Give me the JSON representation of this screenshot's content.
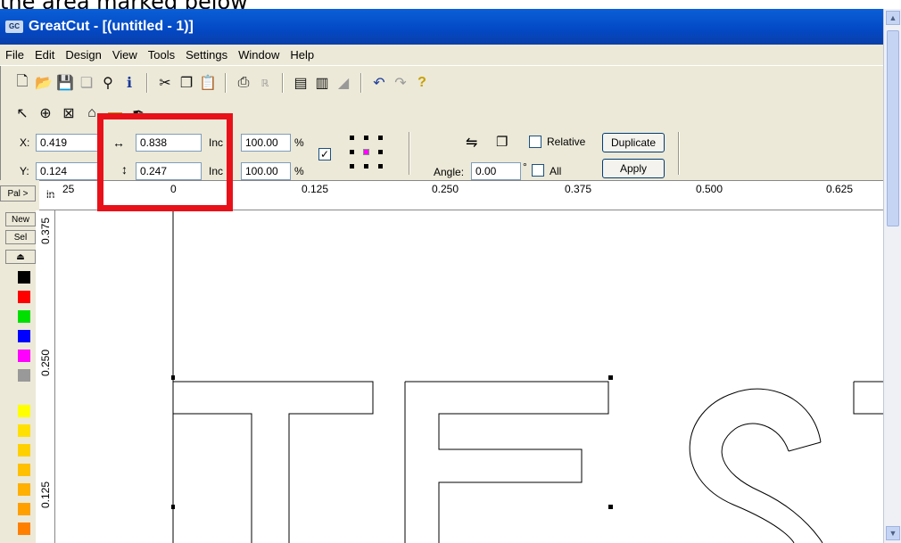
{
  "caption": "the area marked below",
  "window": {
    "title": "GreatCut  - [(untitled - 1)]",
    "icon": "greatcut-app-icon"
  },
  "menu": [
    "File",
    "Edit",
    "Design",
    "View",
    "Tools",
    "Settings",
    "Window",
    "Help"
  ],
  "toolbar": {
    "icons": [
      "new-icon",
      "open-icon",
      "save-icon",
      "gray-icon",
      "preview-icon",
      "info-icon",
      "cut-icon",
      "copy-icon",
      "paste-icon",
      "print-icon",
      "register-icon",
      "page-icon",
      "export-icon",
      "eraser-icon",
      "undo-icon",
      "redo-icon",
      "help-icon"
    ]
  },
  "tools": [
    "pointer-icon",
    "node-icon",
    "frame-icon",
    "text-icon",
    "rectangle-icon",
    "knife-icon"
  ],
  "properties": {
    "x_label": "X:",
    "x_value": "0.419",
    "y_label": "Y:",
    "y_value": "0.124",
    "width_value": "0.838",
    "height_value": "0.247",
    "inc_label": "Inc",
    "scale_w": "100.00",
    "scale_h": "100.00",
    "pct": "%",
    "angle_label": "Angle:",
    "angle_value": "0.00",
    "degree": "°",
    "relative_label": "Relative",
    "all_label": "All",
    "duplicate_label": "Duplicate",
    "apply_label": "Apply"
  },
  "ruler": {
    "unit": "in",
    "top_labels": [
      "25",
      "0",
      "0.125",
      "0.250",
      "0.375",
      "0.500",
      "0.625"
    ],
    "left_labels": [
      "0.375",
      "0.250",
      "0.125"
    ]
  },
  "palette": {
    "pal_label": "Pal >",
    "new_label": "New",
    "sel_label": "Sel"
  },
  "colors": {
    "swatches": [
      "#000000",
      "#ff0000",
      "#00e000",
      "#0000ff",
      "#ff00ff",
      "#999999",
      "#ffffff",
      "#ffff00",
      "#ffe000",
      "#ffd000",
      "#ffc000",
      "#ffb000",
      "#ffa000",
      "#ff9000",
      "#ff8000"
    ],
    "highlight": "#e8111a",
    "titlebar": "#0348c4"
  },
  "canvas_text": "TES"
}
